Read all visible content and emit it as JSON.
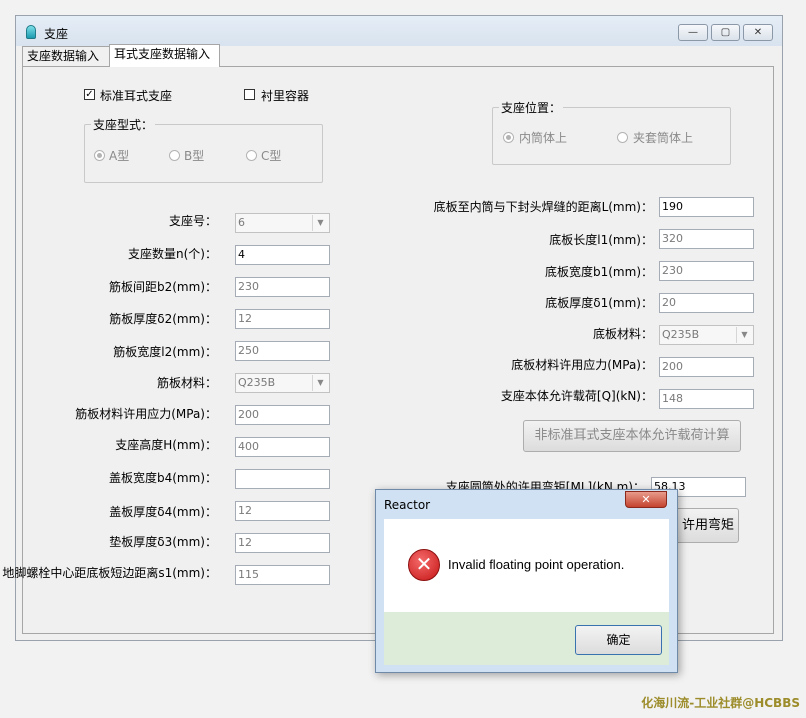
{
  "window": {
    "title": "支座",
    "minimize_glyph": "—",
    "maximize_glyph": "▢",
    "close_glyph": "✕"
  },
  "tabs": [
    {
      "label": "支座数据输入",
      "active": false
    },
    {
      "label": "耳式支座数据输入",
      "active": true
    }
  ],
  "options": {
    "standard_ear_support": {
      "label": "标准耳式支座",
      "checked": true
    },
    "lined_vessel": {
      "label": "衬里容器",
      "checked": false
    }
  },
  "support_type": {
    "title": "支座型式：",
    "options": [
      {
        "label": "A型",
        "selected": true
      },
      {
        "label": "B型",
        "selected": false
      },
      {
        "label": "C型",
        "selected": false
      }
    ]
  },
  "support_position": {
    "title": "支座位置：",
    "options": [
      {
        "label": "内筒体上",
        "selected": true
      },
      {
        "label": "夹套筒体上",
        "selected": false
      }
    ]
  },
  "left_fields": [
    {
      "label": "支座号：",
      "value": "6",
      "type": "select"
    },
    {
      "label": "支座数量n(个)：",
      "value": "4",
      "type": "input"
    },
    {
      "label": "筋板间距b2(mm)：",
      "value": "230",
      "type": "input-disabled"
    },
    {
      "label": "筋板厚度δ2(mm)：",
      "value": "12",
      "type": "input-disabled"
    },
    {
      "label": "筋板宽度l2(mm)：",
      "value": "250",
      "type": "input-disabled"
    },
    {
      "label": "筋板材料：",
      "value": "Q235B",
      "type": "select"
    },
    {
      "label": "筋板材料许用应力(MPa)：",
      "value": "200",
      "type": "input-disabled"
    },
    {
      "label": "支座高度H(mm)：",
      "value": "400",
      "type": "input-disabled"
    },
    {
      "label": "盖板宽度b4(mm)：",
      "value": "",
      "type": "input"
    },
    {
      "label": "盖板厚度δ4(mm)：",
      "value": "12",
      "type": "input-disabled"
    },
    {
      "label": "垫板厚度δ3(mm)：",
      "value": "12",
      "type": "input-disabled"
    },
    {
      "label": "地脚螺栓中心距底板短边距离s1(mm)：",
      "value": "115",
      "type": "input-disabled"
    }
  ],
  "right_fields": [
    {
      "label": "底板至内筒与下封头焊缝的距离L(mm)：",
      "value": "190",
      "type": "input"
    },
    {
      "label": "底板长度l1(mm)：",
      "value": "320",
      "type": "input-disabled"
    },
    {
      "label": "底板宽度b1(mm)：",
      "value": "230",
      "type": "input-disabled"
    },
    {
      "label": "底板厚度δ1(mm)：",
      "value": "20",
      "type": "input-disabled"
    },
    {
      "label": "底板材料：",
      "value": "Q235B",
      "type": "select"
    },
    {
      "label": "底板材料许用应力(MPa)：",
      "value": "200",
      "type": "input-disabled"
    },
    {
      "label": "支座本体允许载荷[Q](kN)：",
      "value": "148",
      "type": "input-disabled"
    }
  ],
  "calc_load_button": "非标准耳式支座本体允许载荷计算",
  "moment": {
    "label": "支座圆筒处的许用弯矩[ML](kN.m)：",
    "value": "58.13"
  },
  "calc_moment_button_partial": "许用弯矩",
  "dialog": {
    "title": "Reactor",
    "close_glyph": "✕",
    "icon_glyph": "✕",
    "message": "Invalid floating point operation.",
    "ok_label": "确定"
  },
  "watermark": "化海川流-工业社群@HCBBS",
  "colors": {
    "accent": "#3a72b0",
    "error": "#c51515",
    "dialog_footer": "#dcecd9"
  }
}
